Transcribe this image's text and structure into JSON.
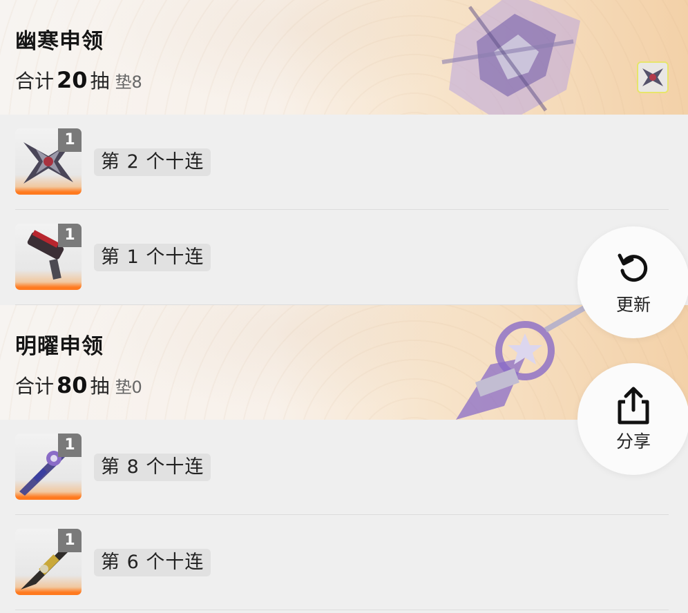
{
  "sections": [
    {
      "title": "幽寒申领",
      "summary": {
        "prefix": "合计",
        "total": "20",
        "unit": "抽",
        "pity": "垫8"
      },
      "rows": [
        {
          "count": "1",
          "label": "第 2 个十连"
        },
        {
          "count": "1",
          "label": "第 1 个十连"
        }
      ]
    },
    {
      "title": "明曜申领",
      "summary": {
        "prefix": "合计",
        "total": "80",
        "unit": "抽",
        "pity": "垫0"
      },
      "rows": [
        {
          "count": "1",
          "label": "第 8 个十连"
        },
        {
          "count": "1",
          "label": "第 6 个十连"
        }
      ]
    }
  ],
  "actions": {
    "refresh_label": "更新",
    "share_label": "分享"
  },
  "icons": {
    "refresh": "refresh-icon",
    "share": "share-icon"
  },
  "colors": {
    "accent_orange": "#ff7a1f",
    "badge_gray": "#7a7a7a",
    "thumb_border": "#e7e56b",
    "purple_art": "#8a6cc7"
  }
}
